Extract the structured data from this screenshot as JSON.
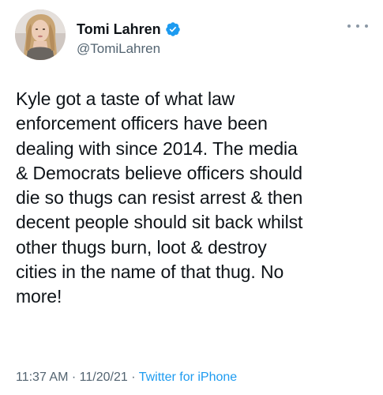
{
  "author": {
    "display_name": "Tomi Lahren",
    "handle": "@TomiLahren",
    "verified": true,
    "verified_icon": "verified-badge-icon",
    "verified_color": "#1d9bf0"
  },
  "menu": {
    "icon": "more-options-icon"
  },
  "tweet": {
    "lines": [
      "Kyle got a taste of what law",
      "enforcement officers have been",
      "dealing with since 2014. The media",
      "& Democrats believe officers should",
      "die so thugs can resist arrest & then",
      "decent people should sit back whilst",
      "other thugs burn, loot & destroy",
      "cities in the name of that thug. No",
      "more!"
    ]
  },
  "meta": {
    "time": "11:37 AM",
    "separator": "·",
    "date": "11/20/21",
    "source": "Twitter for iPhone"
  },
  "colors": {
    "text": "#0f1419",
    "secondary": "#536471",
    "accent": "#1d9bf0"
  }
}
